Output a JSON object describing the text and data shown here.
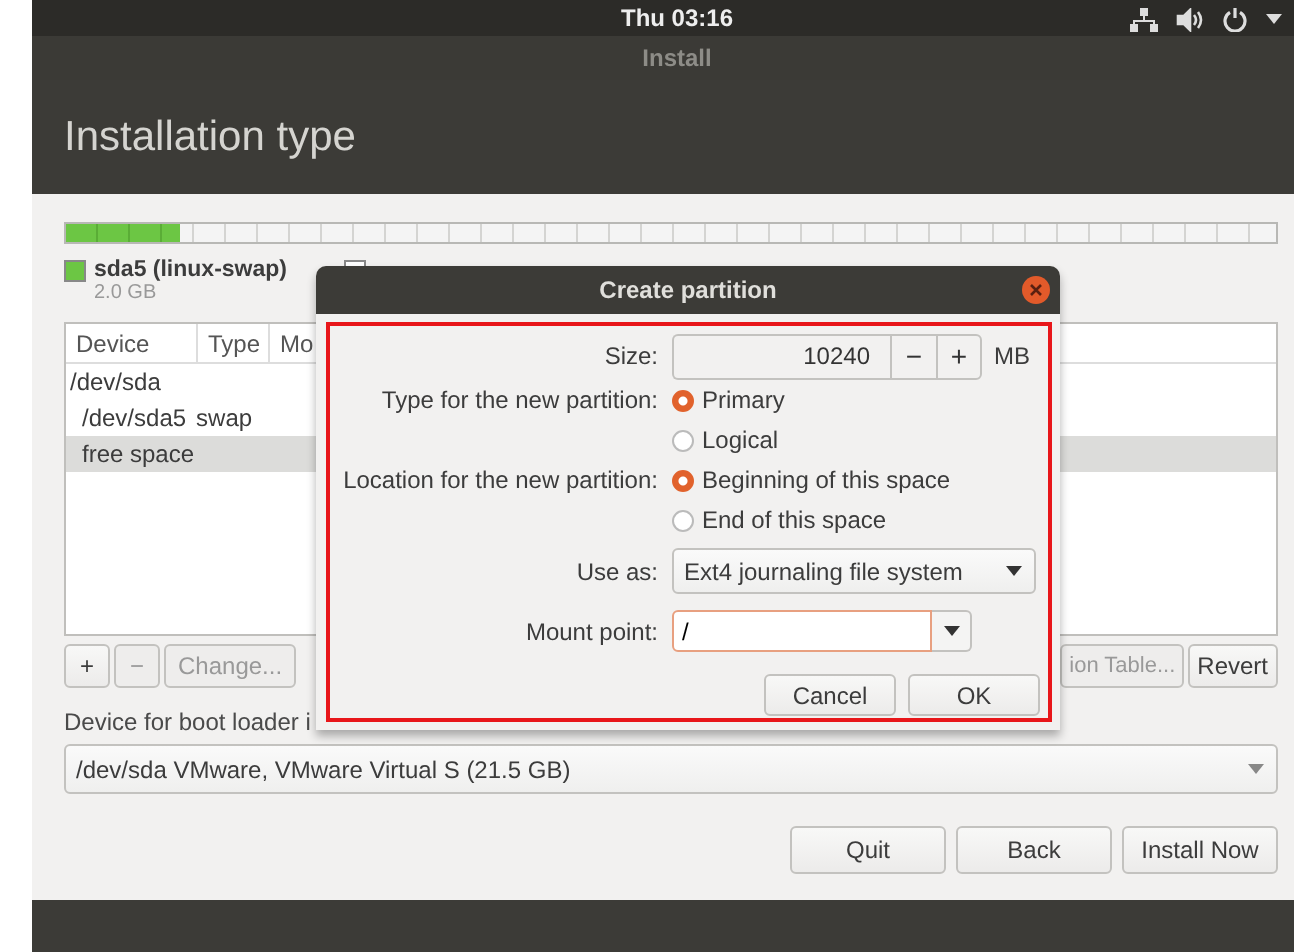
{
  "top_bar": {
    "clock": "Thu 03:16"
  },
  "window": {
    "title": "Install",
    "heading": "Installation type"
  },
  "partition_bar": {
    "level": 0.095
  },
  "legend": [
    {
      "label": "sda5 (linux-swap)",
      "size": "2.0 GB",
      "color": "#6cc644"
    },
    {
      "color": "#ffffff"
    }
  ],
  "table": {
    "columns": [
      "Device",
      "Type",
      "Mo"
    ],
    "rows": [
      {
        "device": "/dev/sda",
        "selected": false,
        "children": [
          {
            "device": "/dev/sda5",
            "type": "swap",
            "selected": false
          },
          {
            "device": "free space",
            "selected": true
          }
        ]
      }
    ]
  },
  "partition_buttons": [
    {
      "label": "+",
      "disabled": false
    },
    {
      "label": "−",
      "disabled": true
    },
    {
      "label": "Change...",
      "disabled": true
    }
  ],
  "table_buttons": [
    {
      "label": "ion Table...",
      "disabled": true
    },
    {
      "label": "Revert",
      "disabled": false
    }
  ],
  "boot_loader": {
    "label": "Device for boot loader i",
    "value": "/dev/sda VMware, VMware Virtual S (21.5 GB)"
  },
  "buttons": [
    "Quit",
    "Back",
    "Install Now"
  ],
  "dialog": {
    "title": "Create partition",
    "size": {
      "label": "Size:",
      "value": "10240",
      "decrement": "−",
      "increment": "+",
      "unit": "MB"
    },
    "type": {
      "label": "Type for the new partition:",
      "options": [
        {
          "label": "Primary",
          "selected": true
        },
        {
          "label": "Logical",
          "selected": false
        }
      ]
    },
    "location": {
      "label": "Location for the new partition:",
      "options": [
        {
          "label": "Beginning of this space",
          "selected": true
        },
        {
          "label": "End of this space",
          "selected": false
        }
      ]
    },
    "use_as": {
      "label": "Use as:",
      "value": "Ext4 journaling file system"
    },
    "mount_point": {
      "label": "Mount point:",
      "value": "/"
    },
    "buttons": [
      "Cancel",
      "OK"
    ]
  }
}
